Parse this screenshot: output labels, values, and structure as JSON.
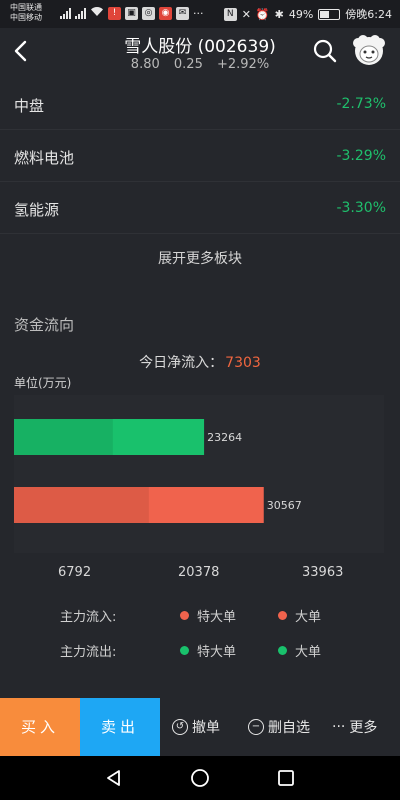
{
  "status_bar": {
    "carrier_1": "中国联通",
    "carrier_2": "中国移动",
    "nfc": "N",
    "battery_pct": "49%",
    "time": "傍晚6:24"
  },
  "header": {
    "title": "雪人股份 (002639)",
    "price": "8.80",
    "change": "0.25",
    "change_pct": "+2.92%"
  },
  "sectors": [
    {
      "name": "中盘",
      "change": "-2.73%"
    },
    {
      "name": "燃料电池",
      "change": "-3.29%"
    },
    {
      "name": "氢能源",
      "change": "-3.30%"
    }
  ],
  "expand_more": "展开更多板块",
  "fund_flow": {
    "title": "资金流向",
    "net_inflow_label": "今日净流入：",
    "net_inflow_value": "7303",
    "unit": "单位(万元)",
    "legend": {
      "inflow_label": "主力流入:",
      "outflow_label": "主力流出:",
      "super_large": "特大单",
      "large": "大单"
    }
  },
  "chart_data": {
    "type": "bar",
    "orientation": "horizontal",
    "stacked": true,
    "bars": [
      {
        "label": "23264",
        "total": 23264,
        "color": "#19c16c"
      },
      {
        "label": "30567",
        "total": 30567,
        "color": "#f0634d"
      }
    ],
    "x_ticks": [
      6792,
      20378,
      33963
    ],
    "xlim": [
      0,
      33963
    ]
  },
  "colors": {
    "inflow": "#f0634d",
    "outflow": "#19c16c",
    "buy": "#f88c3c",
    "sell": "#1ea7f4",
    "down": "#1fbf6c",
    "accent": "#f0663f"
  },
  "actions": {
    "buy": "买入",
    "sell": "卖出",
    "cancel_order": "撤单",
    "remove_watch": "删自选",
    "more": "更多"
  }
}
